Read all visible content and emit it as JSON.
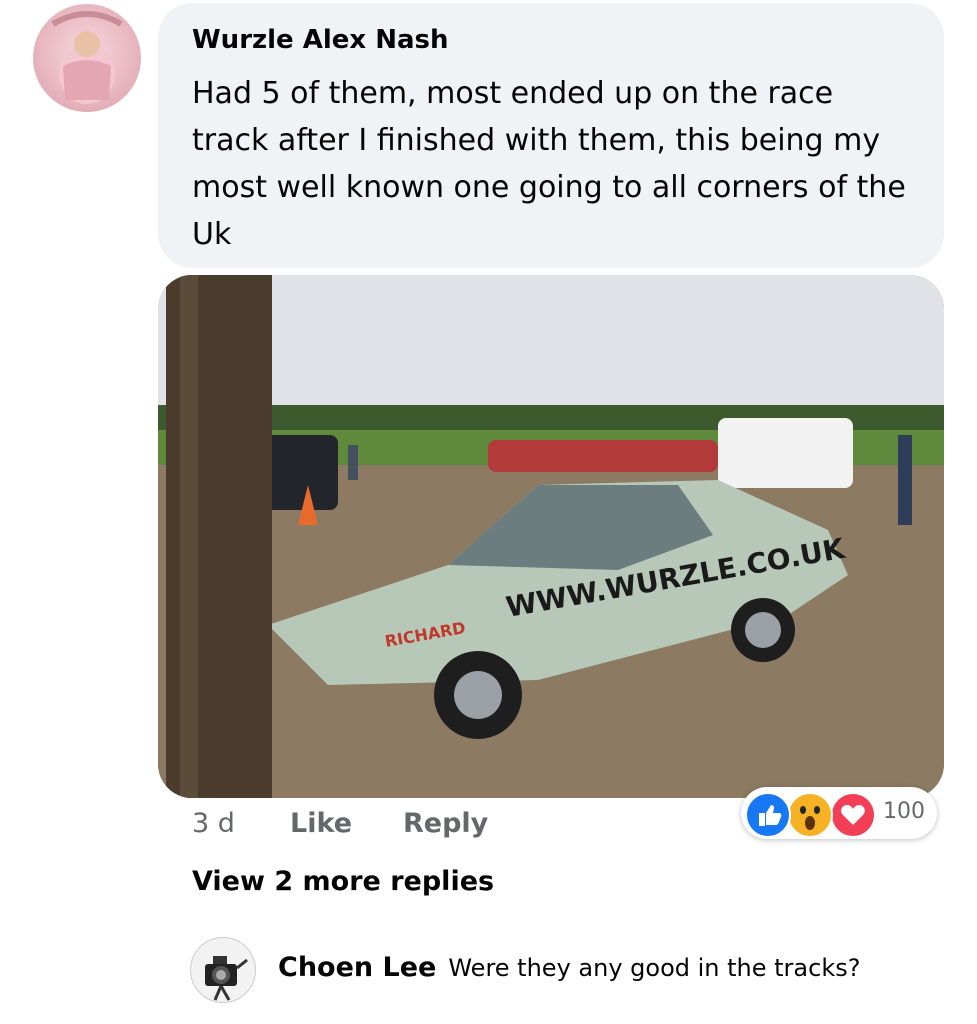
{
  "comment": {
    "author": "Wurzle Alex Nash",
    "text": "Had 5 of them, most ended up on the race track after I finished with them, this being my most well known one going to all corners of the Uk",
    "time": "3 d",
    "like_label": "Like",
    "reply_label": "Reply"
  },
  "photo": {
    "car_lettering": "WWW.WURZLE.CO.UK",
    "door_lettering": "RICHARD"
  },
  "reactions": {
    "icons": [
      "like-icon",
      "wow-icon",
      "love-icon"
    ],
    "count": "100",
    "colors": {
      "like": "#1877f2",
      "wow": "#f7b125",
      "love": "#f33e58"
    }
  },
  "view_more_replies": "View 2 more replies",
  "reply": {
    "author": "Choen Lee",
    "text": "Were they any good in the tracks?"
  }
}
